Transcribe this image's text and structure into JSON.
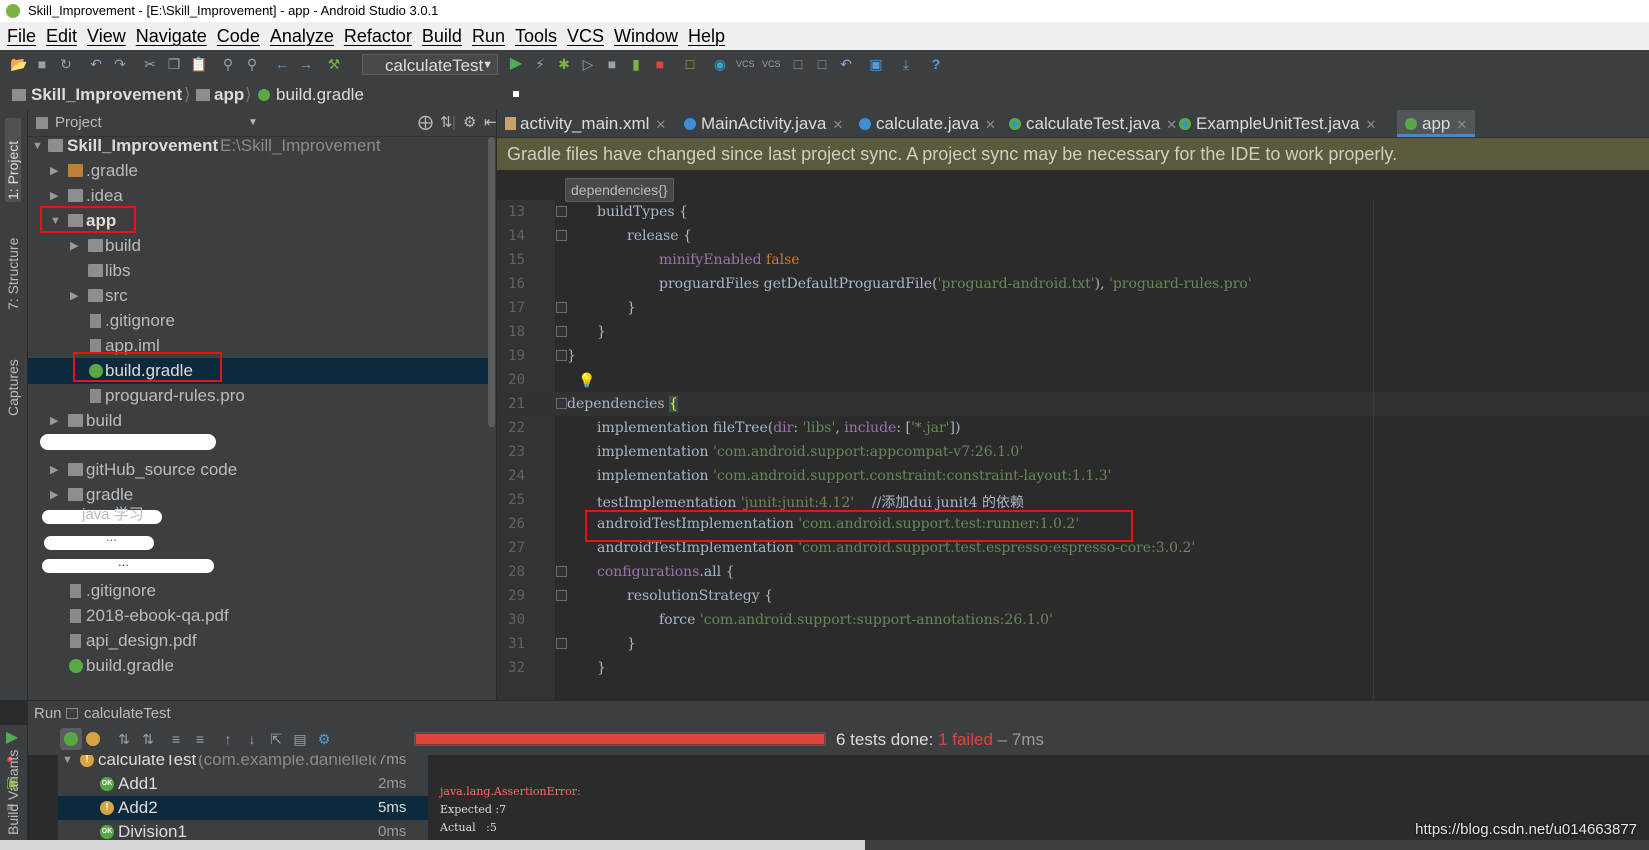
{
  "window": {
    "title": "Skill_Improvement - [E:\\Skill_Improvement] - app - Android Studio 3.0.1"
  },
  "menu": [
    "File",
    "Edit",
    "View",
    "Navigate",
    "Code",
    "Analyze",
    "Refactor",
    "Build",
    "Run",
    "Tools",
    "VCS",
    "Window",
    "Help"
  ],
  "toolbar": {
    "run_config": "calculateTest"
  },
  "breadcrumb": [
    "Skill_Improvement",
    "app",
    "build.gradle"
  ],
  "side_tabs": {
    "project": "1: Project",
    "structure": "7: Structure",
    "captures": "Captures",
    "build_variants": "Build Variants"
  },
  "project": {
    "header": "Project",
    "root_name": "Skill_Improvement",
    "root_path": "E:\\Skill_Improvement",
    "items": [
      ".gradle",
      ".idea",
      "app",
      "build",
      "libs",
      "src",
      ".gitignore",
      "app.iml",
      "build.gradle",
      "proguard-rules.pro",
      "build",
      "gitHub_source code",
      "gradle",
      ".gitignore",
      "2018-ebook-qa.pdf",
      "api_design.pdf",
      "build.gradle"
    ],
    "redacted": [
      "java 学习",
      "...",
      "..."
    ]
  },
  "tabs": [
    "activity_main.xml",
    "MainActivity.java",
    "calculate.java",
    "calculateTest.java",
    "ExampleUnitTest.java",
    "app"
  ],
  "notification": "Gradle files have changed since last project sync. A project sync may be necessary for the IDE to work properly.",
  "editor_crumb": "dependencies{}",
  "code": {
    "line_numbers": [
      "13",
      "14",
      "15",
      "16",
      "17",
      "18",
      "19",
      "20",
      "21",
      "22",
      "23",
      "24",
      "25",
      "26",
      "27",
      "28",
      "29",
      "30",
      "31",
      "32"
    ],
    "l13": "buildTypes {",
    "l14": "release {",
    "l15a": "minifyEnabled",
    "l15b": " false",
    "l16a": "proguardFiles getDefaultProguardFile(",
    "l16b": "'proguard-android.txt'",
    "l16c": "), ",
    "l16d": "'proguard-rules.pro'",
    "l17": "}",
    "l18": "}",
    "l19": "}",
    "l21a": "dependencies ",
    "l21b": "{",
    "l22a": "implementation fileTree(",
    "l22b": "dir",
    "l22c": ": ",
    "l22d": "'libs'",
    "l22e": ", ",
    "l22f": "include",
    "l22g": ": [",
    "l22h": "'*.jar'",
    "l22i": "])",
    "l23a": "implementation ",
    "l23b": "'com.android.support:appcompat-v7:26.1.0'",
    "l24a": "implementation ",
    "l24b": "'com.android.support.constraint:constraint-layout:1.1.3'",
    "l25a": "testImplementation ",
    "l25b": "'junit:junit:4.12'",
    "l25c": "    //添加dui junit4 的依赖",
    "l26a": "androidTestImplementation ",
    "l26b": "'com.android.support.test:runner:1.0.2'",
    "l27a": "androidTestImplementation ",
    "l27b": "'com.android.support.test.espresso:espresso-core:3.0.2'",
    "l28a": "configurations",
    "l28b": ".all {",
    "l29": "resolutionStrategy {",
    "l30a": "force ",
    "l30b": "'com.android.support:support-annotations:26.1.0'",
    "l31": "}",
    "l32": "}"
  },
  "run": {
    "header_label": "Run",
    "config": "calculateTest",
    "summary_done": "6 tests done: ",
    "summary_failed": "1 failed",
    "summary_time": " – 7ms",
    "tree": [
      {
        "name": "calculateTest",
        "detail": "(com.example.danielleloi",
        "time": "7ms"
      },
      {
        "name": "Add1",
        "time": "2ms"
      },
      {
        "name": "Add2",
        "time": "5ms"
      },
      {
        "name": "Division1",
        "time": "0ms"
      }
    ],
    "output": [
      "java.lang.AssertionError:",
      "Expected :7",
      "Actual   :5"
    ]
  },
  "watermark": "https://blog.csdn.net/u014663877"
}
